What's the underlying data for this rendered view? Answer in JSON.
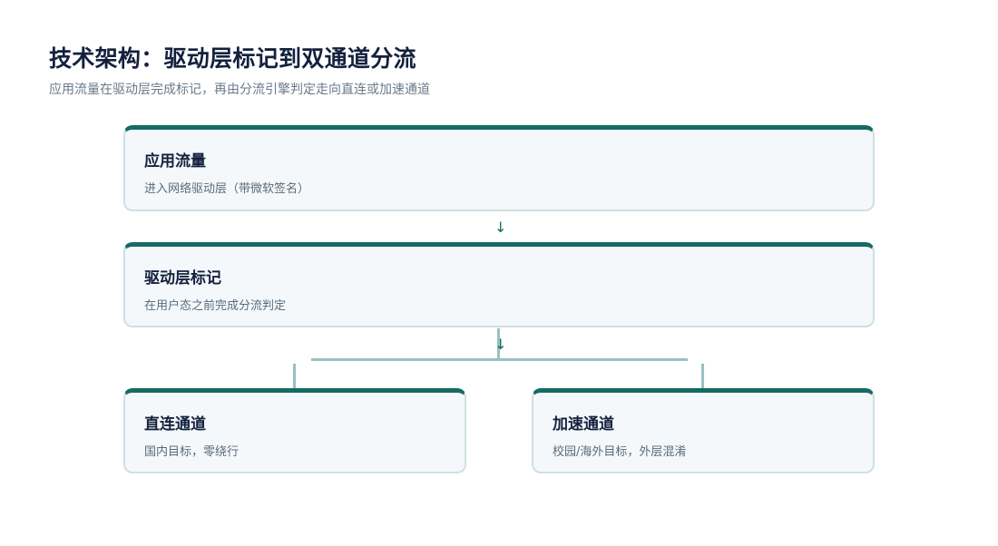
{
  "header": {
    "title": "技术架构：驱动层标记到双通道分流",
    "subtitle": "应用流量在驱动层完成标记，再由分流引擎判定走向直连或加速通道"
  },
  "nodes": {
    "app_traffic": {
      "title": "应用流量",
      "description": "进入网络驱动层（带微软签名）"
    },
    "driver_marking": {
      "title": "驱动层标记",
      "description": "在用户态之前完成分流判定"
    },
    "direct_channel": {
      "title": "直连通道",
      "description": "国内目标，零绕行"
    },
    "accel_channel": {
      "title": "加速通道",
      "description": "校园/海外目标，外层混淆"
    }
  },
  "arrows": {
    "down_glyph": "↓"
  },
  "colors": {
    "accent": "#156b63",
    "card_background": "#f4f8fb",
    "card_border": "#cfe0e3",
    "connector": "#9ac0bf",
    "title_text": "#14213d",
    "muted_text": "#6a7a89"
  }
}
